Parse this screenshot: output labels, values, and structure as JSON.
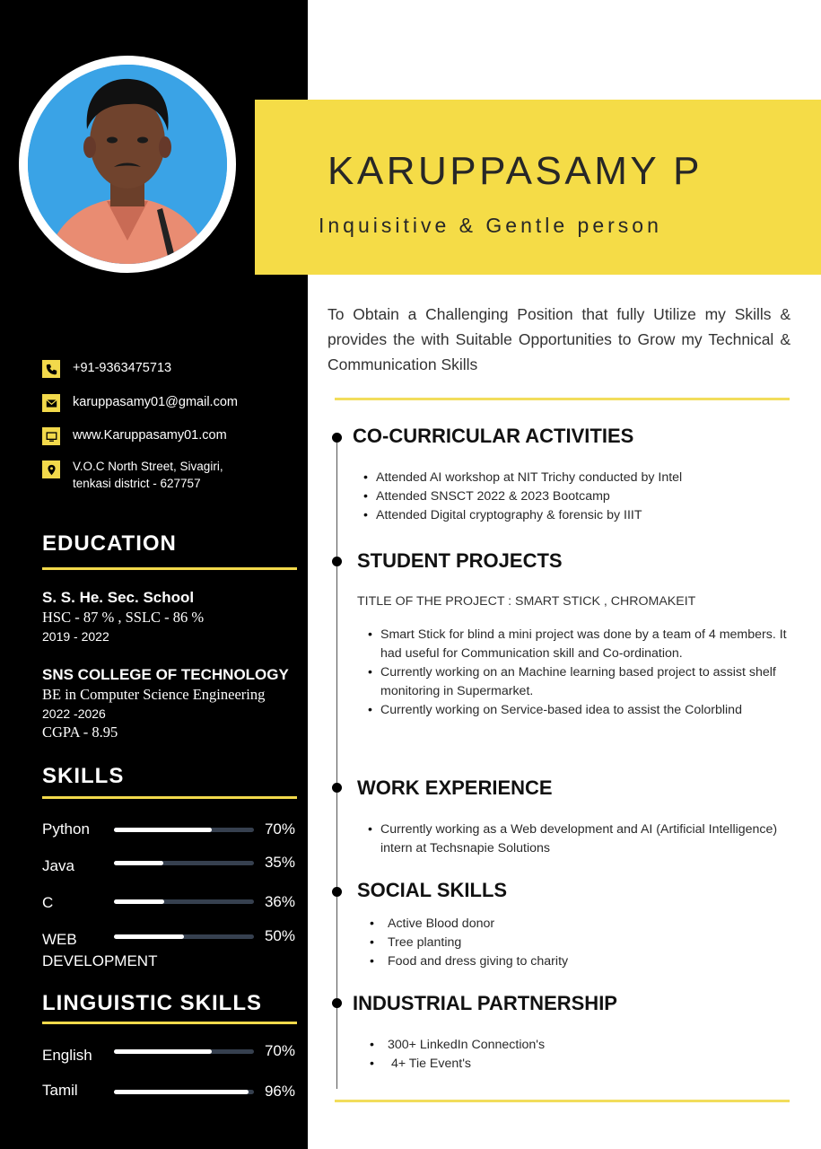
{
  "header": {
    "name": "KARUPPASAMY P",
    "tagline": "Inquisitive & Gentle person"
  },
  "contact": {
    "phone": "+91-9363475713",
    "email": "karuppasamy01@gmail.com",
    "website": "www.Karuppasamy01.com",
    "address_line1": "V.O.C North Street, Sivagiri,",
    "address_line2": "tenkasi district - 627757"
  },
  "education": {
    "title": "EDUCATION",
    "entries": [
      {
        "school": "S. S. He. Sec. School",
        "detail": "HSC - 87 % , SSLC - 86 %",
        "years": "2019 - 2022"
      },
      {
        "school": "SNS COLLEGE OF TECHNOLOGY",
        "detail": "BE in Computer Science Engineering",
        "years": "2022 -2026",
        "extra": "CGPA - 8.95"
      }
    ]
  },
  "skills": {
    "title": "SKILLS",
    "items": [
      {
        "name": "Python",
        "percent_label": "70%",
        "level": 0.7
      },
      {
        "name": "Java",
        "percent_label": "35%",
        "level": 0.35
      },
      {
        "name": "C",
        "percent_label": "36%",
        "level": 0.36
      },
      {
        "name": "WEB DEVELOPMENT",
        "percent_label": "50%",
        "level": 0.5
      }
    ]
  },
  "languages": {
    "title": "LINGUISTIC SKILLS",
    "items": [
      {
        "name": "English",
        "percent_label": "70%",
        "level": 0.7
      },
      {
        "name": "Tamil",
        "percent_label": "96%",
        "level": 0.96
      }
    ]
  },
  "objective": "To Obtain a Challenging Position that fully Utilize my Skills & provides the with Suitable Opportunities to Grow my Technical & Communication Skills",
  "cocurricular": {
    "title": "CO-CURRICULAR ACTIVITIES",
    "items": [
      "Attended AI workshop at NIT Trichy conducted by Intel",
      "Attended SNSCT 2022 & 2023 Bootcamp",
      "Attended Digital cryptography & forensic by IIIT"
    ]
  },
  "projects": {
    "title": "STUDENT PROJECTS",
    "project_title": "TITLE OF THE PROJECT :  SMART STICK , CHROMAKEIT",
    "items": [
      "Smart Stick for blind a mini project was done by a team of 4 members. It had useful for Communication skill and Co-ordination.",
      "Currently working on an Machine learning based project to assist shelf monitoring in Supermarket.",
      "Currently working  on  Service-based idea to assist the Colorblind"
    ]
  },
  "work": {
    "title": "WORK EXPERIENCE",
    "items": [
      "Currently working as a Web development and AI (Artificial Intelligence) intern at Techsnapie Solutions"
    ]
  },
  "social": {
    "title": "SOCIAL SKILLS",
    "items": [
      "Active Blood donor",
      "Tree planting",
      "Food and dress giving to charity"
    ]
  },
  "industrial": {
    "title": "INDUSTRIAL PARTNERSHIP",
    "items": [
      "300+ LinkedIn Connection's",
      " 4+ Tie Event's"
    ]
  },
  "colors": {
    "sidebar": "#000000",
    "accent": "#f5dc47",
    "bar_track": "#36404f",
    "bar_fill": "#ffffff"
  }
}
